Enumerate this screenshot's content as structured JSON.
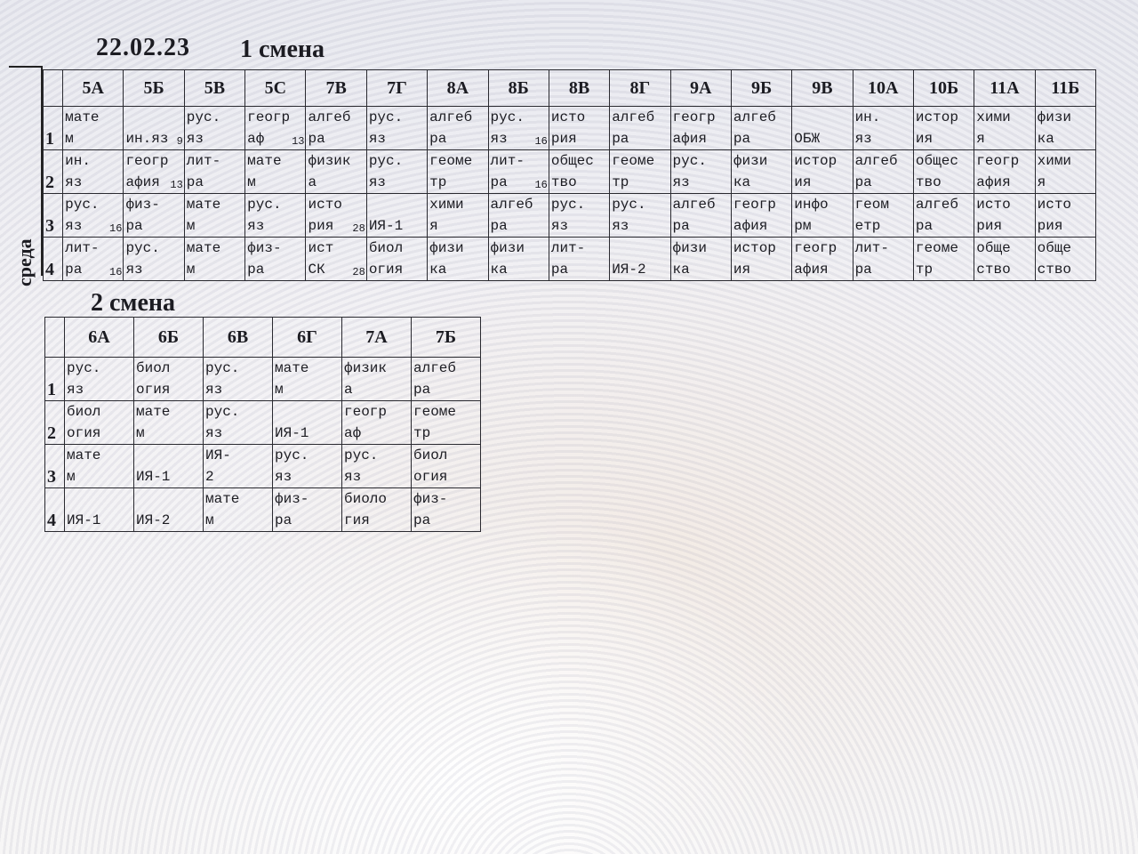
{
  "date": "22.02.23",
  "day": "среда",
  "shift1": {
    "title": "1 смена",
    "classes": [
      "5А",
      "5Б",
      "5В",
      "5С",
      "7В",
      "7Г",
      "8А",
      "8Б",
      "8В",
      "8Г",
      "9А",
      "9Б",
      "9В",
      "10А",
      "10Б",
      "11А",
      "11Б"
    ],
    "rows": [
      {
        "n": "1",
        "cells": [
          {
            "t": "мате\nм"
          },
          {
            "t": "\nин.яз",
            "room": "9"
          },
          {
            "t": "рус.\nяз"
          },
          {
            "t": "геогр\nаф",
            "room": "13"
          },
          {
            "t": "алгеб\nра"
          },
          {
            "t": "рус.\nяз"
          },
          {
            "t": "алгеб\nра"
          },
          {
            "t": "рус.\nяз",
            "room": "16"
          },
          {
            "t": "исто\nрия"
          },
          {
            "t": "алгеб\nра"
          },
          {
            "t": "геогр\nафия"
          },
          {
            "t": "алгеб\nра"
          },
          {
            "t": "\nОБЖ"
          },
          {
            "t": "ин.\nяз"
          },
          {
            "t": "истор\nия"
          },
          {
            "t": "хими\nя"
          },
          {
            "t": "физи\nка"
          }
        ]
      },
      {
        "n": "2",
        "cells": [
          {
            "t": "ин.\nяз"
          },
          {
            "t": "геогр\nафия",
            "room": "13"
          },
          {
            "t": "лит-\nра"
          },
          {
            "t": "мате\nм"
          },
          {
            "t": "физик\nа"
          },
          {
            "t": "рус.\nяз"
          },
          {
            "t": "геоме\nтр"
          },
          {
            "t": "лит-\nра",
            "room": "16"
          },
          {
            "t": "общес\nтво"
          },
          {
            "t": "геоме\nтр"
          },
          {
            "t": "рус.\nяз"
          },
          {
            "t": "физи\nка"
          },
          {
            "t": "истор\nия"
          },
          {
            "t": "алгеб\nра"
          },
          {
            "t": "общес\nтво"
          },
          {
            "t": "геогр\nафия"
          },
          {
            "t": "хими\nя"
          }
        ]
      },
      {
        "n": "3",
        "cells": [
          {
            "t": "рус.\nяз",
            "room": "16"
          },
          {
            "t": "физ-\nра"
          },
          {
            "t": "мате\nм"
          },
          {
            "t": "рус.\nяз"
          },
          {
            "t": "исто\nрия",
            "room": "28"
          },
          {
            "t": "\nИЯ-1"
          },
          {
            "t": "хими\nя"
          },
          {
            "t": "алгеб\nра"
          },
          {
            "t": "рус.\nяз"
          },
          {
            "t": "рус.\nяз"
          },
          {
            "t": "алгеб\nра"
          },
          {
            "t": "геогр\nафия"
          },
          {
            "t": "инфо\nрм"
          },
          {
            "t": "геом\nетр"
          },
          {
            "t": "алгеб\nра"
          },
          {
            "t": "исто\nрия"
          },
          {
            "t": "исто\nрия"
          }
        ]
      },
      {
        "n": "4",
        "cells": [
          {
            "t": "лит-\nра",
            "room": "16"
          },
          {
            "t": "рус.\nяз"
          },
          {
            "t": "мате\nм"
          },
          {
            "t": "физ-\nра"
          },
          {
            "t": "ист\nСК",
            "room": "28"
          },
          {
            "t": "биол\nогия"
          },
          {
            "t": "физи\nка"
          },
          {
            "t": "физи\nка"
          },
          {
            "t": "лит-\nра"
          },
          {
            "t": "\nИЯ-2"
          },
          {
            "t": "физи\nка"
          },
          {
            "t": "истор\nия"
          },
          {
            "t": "геогр\nафия"
          },
          {
            "t": "лит-\nра"
          },
          {
            "t": "геоме\nтр"
          },
          {
            "t": "обще\nство"
          },
          {
            "t": "обще\nство"
          }
        ]
      }
    ]
  },
  "shift2": {
    "title": "2 смена",
    "classes": [
      "6А",
      "6Б",
      "6В",
      "6Г",
      "7А",
      "7Б"
    ],
    "rows": [
      {
        "n": "1",
        "cells": [
          {
            "t": "рус.\nяз"
          },
          {
            "t": "биол\nогия"
          },
          {
            "t": "рус.\nяз"
          },
          {
            "t": "мате\nм"
          },
          {
            "t": "физик\nа"
          },
          {
            "t": "алгеб\nра"
          }
        ]
      },
      {
        "n": "2",
        "cells": [
          {
            "t": "биол\nогия"
          },
          {
            "t": "мате\nм"
          },
          {
            "t": "рус.\nяз"
          },
          {
            "t": "\nИЯ-1"
          },
          {
            "t": "геогр\nаф"
          },
          {
            "t": "геоме\nтр"
          }
        ]
      },
      {
        "n": "3",
        "cells": [
          {
            "t": "мате\nм"
          },
          {
            "t": "\nИЯ-1"
          },
          {
            "t": "ИЯ-\n2"
          },
          {
            "t": "рус.\nяз"
          },
          {
            "t": "рус.\nяз"
          },
          {
            "t": "биол\nогия"
          }
        ]
      },
      {
        "n": "4",
        "cells": [
          {
            "t": "\nИЯ-1"
          },
          {
            "t": "\nИЯ-2"
          },
          {
            "t": "мате\nм"
          },
          {
            "t": "физ-\nра"
          },
          {
            "t": "биоло\nгия"
          },
          {
            "t": "физ-\nра"
          }
        ]
      }
    ]
  }
}
